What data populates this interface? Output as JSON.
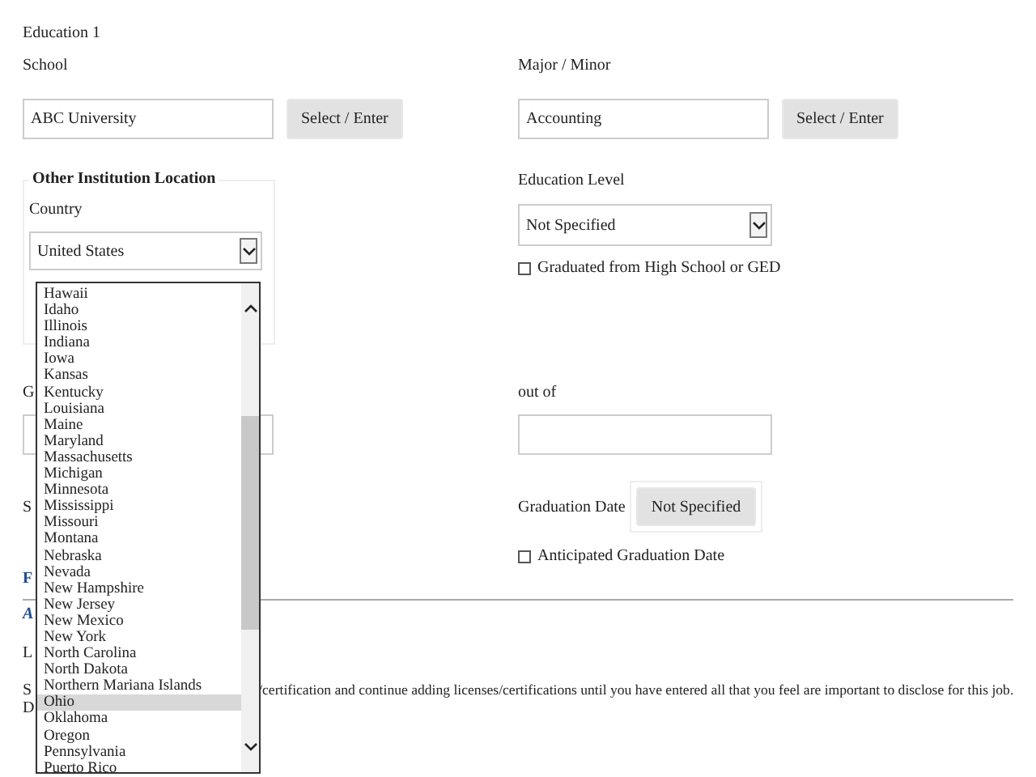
{
  "section_title": "Education 1",
  "school": {
    "label": "School",
    "value": "ABC University",
    "button": "Select / Enter"
  },
  "major": {
    "label": "Major / Minor",
    "value": "Accounting",
    "button": "Select / Enter"
  },
  "location": {
    "legend": "Other Institution Location",
    "country_label": "Country",
    "country_value": "United States",
    "expanded": true,
    "options": [
      {
        "label": "Hawaii",
        "selected": false
      },
      {
        "label": "Idaho",
        "selected": false
      },
      {
        "label": "Illinois",
        "selected": false
      },
      {
        "label": "Indiana",
        "selected": false
      },
      {
        "label": "Iowa",
        "selected": false
      },
      {
        "label": "Kansas",
        "selected": false
      },
      {
        "label": "Kentucky",
        "selected": false
      },
      {
        "label": "Louisiana",
        "selected": false
      },
      {
        "label": "Maine",
        "selected": false
      },
      {
        "label": "Maryland",
        "selected": false
      },
      {
        "label": "Massachusetts",
        "selected": false
      },
      {
        "label": "Michigan",
        "selected": false
      },
      {
        "label": "Minnesota",
        "selected": false
      },
      {
        "label": "Mississippi",
        "selected": false
      },
      {
        "label": "Missouri",
        "selected": false
      },
      {
        "label": "Montana",
        "selected": false
      },
      {
        "label": "Nebraska",
        "selected": false
      },
      {
        "label": "Nevada",
        "selected": false
      },
      {
        "label": "New Hampshire",
        "selected": false
      },
      {
        "label": "New Jersey",
        "selected": false
      },
      {
        "label": "New Mexico",
        "selected": false
      },
      {
        "label": "New York",
        "selected": false
      },
      {
        "label": "North Carolina",
        "selected": false
      },
      {
        "label": "North Dakota",
        "selected": false
      },
      {
        "label": "Northern Mariana Islands",
        "selected": false
      },
      {
        "label": "Ohio",
        "selected": true
      },
      {
        "label": "Oklahoma",
        "selected": false
      },
      {
        "label": "Oregon",
        "selected": false
      },
      {
        "label": "Pennsylvania",
        "selected": false
      },
      {
        "label": "Puerto Rico",
        "selected": false
      }
    ]
  },
  "education_level": {
    "label": "Education Level",
    "value": "Not Specified",
    "checkbox": {
      "label": "Graduated from High School or GED",
      "checked": false
    }
  },
  "out_of": {
    "label": "out of"
  },
  "graduation": {
    "label": "Graduation Date",
    "button": "Not Specified",
    "checkbox": {
      "label": "Anticipated Graduation Date",
      "checked": false
    }
  },
  "covered_left_texts": {
    "row_1": "G",
    "row_2": "S",
    "row_3": "F",
    "row_4": "A",
    "row_5": "L",
    "row_6": "S",
    "row_7": "D"
  },
  "instructions_tail": "/certification and continue adding licenses/certifications until you have entered all that you feel are important to disclose for this job."
}
